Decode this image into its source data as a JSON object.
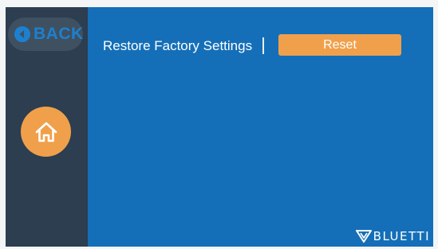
{
  "sidebar": {
    "back_label": "BACK",
    "back_icon": "chevron-left-circle-icon",
    "home_icon": "home-icon"
  },
  "settings": {
    "restore_label": "Restore Factory Settings",
    "reset_button_label": "Reset"
  },
  "brand": {
    "name": "BLUETTI"
  },
  "colors": {
    "screen_bg": "#146fb8",
    "sidebar_bg": "#2c3e50",
    "accent_orange": "#f0a04b",
    "back_text": "#1d80cf"
  }
}
